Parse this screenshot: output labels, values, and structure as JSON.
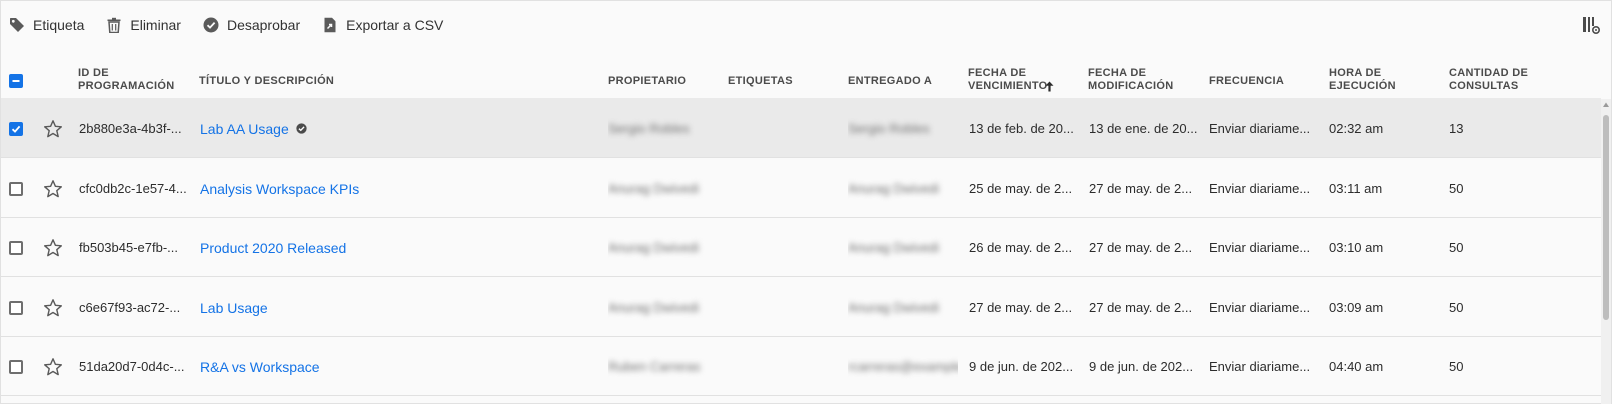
{
  "toolbar": {
    "tag_label": "Etiqueta",
    "delete_label": "Eliminar",
    "unapprove_label": "Desaprobar",
    "export_label": "Exportar a CSV"
  },
  "columns": {
    "id": "ID DE\nPROGRAMACIÓN",
    "title": "TÍTULO Y DESCRIPCIÓN",
    "owner": "PROPIETARIO",
    "tags": "ETIQUETAS",
    "delivered_to": "ENTREGADO A",
    "due_date": "FECHA DE\nVENCIMIENTO",
    "modified_date": "FECHA DE\nMODIFICACIÓN",
    "frequency": "FRECUENCIA",
    "run_time": "HORA DE\nEJECUCIÓN",
    "query_count": "CANTIDAD DE\nCONSULTAS"
  },
  "sort": {
    "column": "due_date",
    "direction": "ascending"
  },
  "rows": [
    {
      "id": "2b880e3a-4b3f-...",
      "title": "Lab AA Usage",
      "approved": true,
      "selected": true,
      "owner": "Sergio Robles",
      "delivered_to": "Sergio Robles",
      "due_date": "13 de feb. de 20...",
      "modified_date": "13 de ene. de 20...",
      "frequency": "Enviar diariame...",
      "run_time": "02:32 am",
      "query_count": "13"
    },
    {
      "id": "cfc0db2c-1e57-4...",
      "title": "Analysis Workspace KPIs",
      "approved": false,
      "selected": false,
      "owner": "Anurag Dwivedi",
      "delivered_to": "Anurag Dwivedi",
      "due_date": "25 de may. de 2...",
      "modified_date": "27 de may. de 2...",
      "frequency": "Enviar diariame...",
      "run_time": "03:11 am",
      "query_count": "50"
    },
    {
      "id": "fb503b45-e7fb-...",
      "title": "Product 2020 Released",
      "approved": false,
      "selected": false,
      "owner": "Anurag Dwivedi",
      "delivered_to": "Anurag Dwivedi",
      "due_date": "26 de may. de 2...",
      "modified_date": "27 de may. de 2...",
      "frequency": "Enviar diariame...",
      "run_time": "03:10 am",
      "query_count": "50"
    },
    {
      "id": "c6e67f93-ac72-...",
      "title": "Lab Usage",
      "approved": false,
      "selected": false,
      "owner": "Anurag Dwivedi",
      "delivered_to": "Anurag Dwivedi",
      "due_date": "27 de may. de 2...",
      "modified_date": "27 de may. de 2...",
      "frequency": "Enviar diariame...",
      "run_time": "03:09 am",
      "query_count": "50"
    },
    {
      "id": "51da20d7-0d4c-...",
      "title": "R&A vs Workspace",
      "approved": false,
      "selected": false,
      "owner": "Ruben Carreras",
      "delivered_to": "rcarreras@example...",
      "due_date": "9 de jun. de 202...",
      "modified_date": "9 de jun. de 202...",
      "frequency": "Enviar diariame...",
      "run_time": "04:40 am",
      "query_count": "50"
    }
  ],
  "colors": {
    "link": "#1473e6",
    "checkbox_checked": "#1473e6",
    "selected_row": "#eaeaea"
  }
}
